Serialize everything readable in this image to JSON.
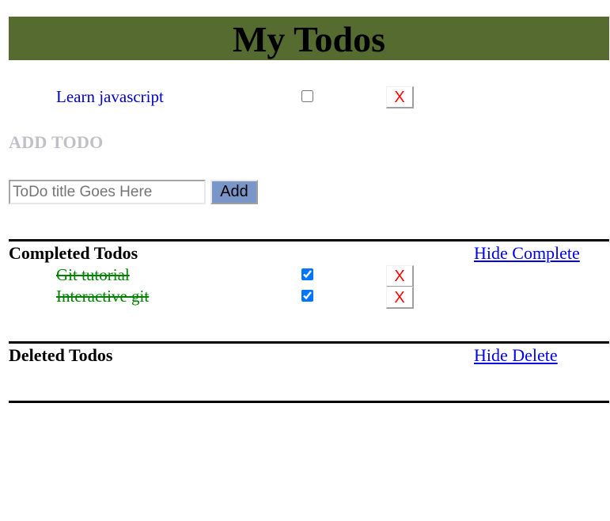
{
  "header": {
    "title": "My Todos"
  },
  "active_todos": [
    {
      "title": "Learn javascript",
      "checked": false,
      "delete_label": "X"
    }
  ],
  "add_section": {
    "heading": "ADD TODO",
    "input_placeholder": "ToDo title Goes Here",
    "input_value": "",
    "add_label": "Add"
  },
  "completed": {
    "title": "Completed Todos",
    "toggle_label": "Hide Complete",
    "items": [
      {
        "title": "Git tutorial",
        "checked": true,
        "delete_label": "X"
      },
      {
        "title": "Interactive git",
        "checked": true,
        "delete_label": "X"
      }
    ]
  },
  "deleted": {
    "title": "Deleted Todos",
    "toggle_label": "Hide Delete",
    "items": []
  },
  "colors": {
    "header_bg": "#556b2f",
    "active_text": "#0000cd",
    "completed_text": "#008000",
    "delete_x": "#ff0000",
    "add_button_bg": "#7a96c8",
    "link": "#0000ee"
  }
}
